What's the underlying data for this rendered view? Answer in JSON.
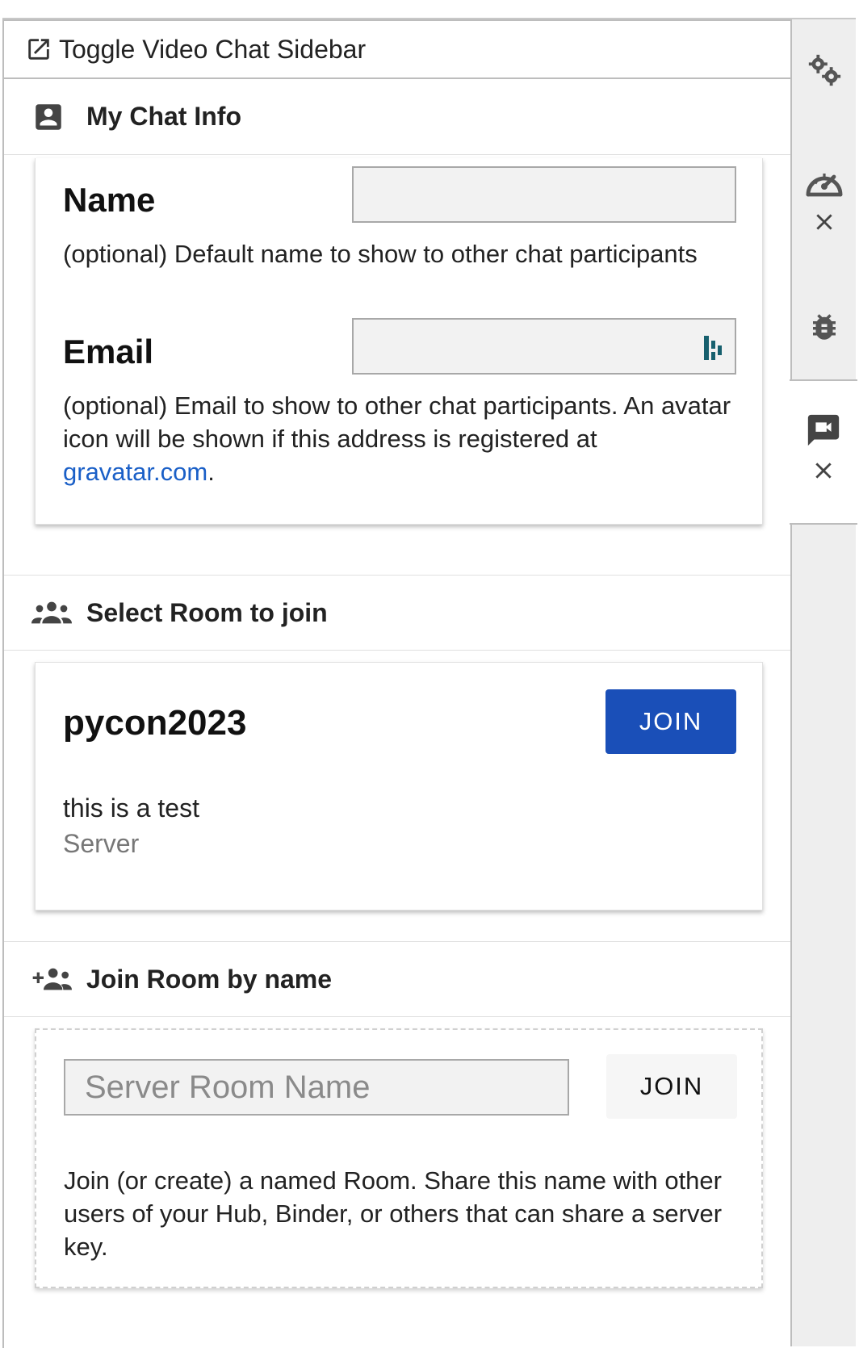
{
  "toggle": {
    "label": "Toggle Video Chat Sidebar",
    "icon": "open-in-new-icon"
  },
  "chat_info": {
    "header": "My Chat Info",
    "icon": "account-box-icon",
    "name_label": "Name",
    "name_value": "",
    "name_help": "(optional) Default name to show to other chat participants",
    "email_label": "Email",
    "email_value": "",
    "email_help_prefix": "(optional) Email to show to other chat participants. An avatar icon will be shown if this address is registered at ",
    "email_help_link": "gravatar.com",
    "email_help_suffix": "."
  },
  "select_room": {
    "header": "Select Room to join",
    "icon": "group-icon",
    "room": {
      "name": "pycon2023",
      "join_label": "JOIN",
      "description": "this is a test",
      "source": "Server"
    }
  },
  "join_by_name": {
    "header": "Join Room by name",
    "icon": "group-add-icon",
    "placeholder": "Server Room Name",
    "value": "",
    "join_label": "JOIN",
    "help": "Join (or create) a named Room. Share this name with other users of your Hub, Binder, or others that can share a server key."
  },
  "sidebar": {
    "tabs": [
      {
        "icon": "property-inspector-icon",
        "closable": false
      },
      {
        "icon": "gauge-icon",
        "closable": true
      },
      {
        "icon": "debugger-icon",
        "closable": false
      },
      {
        "icon": "video-chat-icon",
        "closable": true,
        "active": true
      }
    ]
  },
  "colors": {
    "primary_button": "#1a4fb8",
    "link": "#1a5fc7",
    "sidebar_bg": "#eeeeee",
    "muted_text": "#777777"
  }
}
